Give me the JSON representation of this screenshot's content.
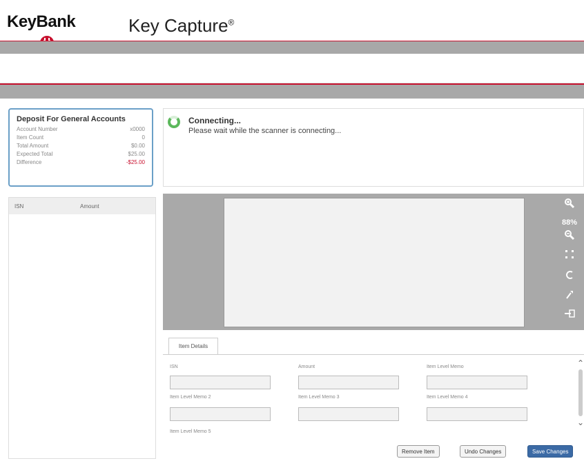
{
  "header": {
    "logo": "KeyBank",
    "app_title": "Key Capture",
    "app_title_mark": "®",
    "colors": {
      "brand_red": "#c8102e",
      "band_gray": "#a8a8a8"
    }
  },
  "deposit": {
    "title": "Deposit For General Accounts",
    "rows": [
      {
        "label": "Account Number",
        "value": "x0000"
      },
      {
        "label": "Item Count",
        "value": "0"
      },
      {
        "label": "Total Amount",
        "value": "$0.00"
      },
      {
        "label": "Expected Total",
        "value": "$25.00"
      },
      {
        "label": "Difference",
        "value": "-$25.00"
      }
    ]
  },
  "item_list": {
    "columns": [
      "ISN",
      "Amount"
    ]
  },
  "connection": {
    "title": "Connecting...",
    "message": "Please wait while the scanner is connecting..."
  },
  "viewer": {
    "zoom": "88%",
    "tools": [
      "zoom-in-icon",
      "zoom-out-icon",
      "fit-icon",
      "rotate-icon",
      "pin-icon",
      "exit-icon"
    ]
  },
  "item_details": {
    "tab": "Item Details",
    "fields": [
      {
        "label": "ISN",
        "value": ""
      },
      {
        "label": "Amount",
        "value": ""
      },
      {
        "label": "Item Level Memo",
        "value": ""
      },
      {
        "label": "Item Level Memo 2",
        "value": ""
      },
      {
        "label": "Item Level Memo 3",
        "value": ""
      },
      {
        "label": "Item Level Memo 4",
        "value": ""
      },
      {
        "label": "Item Level Memo 5",
        "value": ""
      }
    ]
  },
  "actions": {
    "remove": "Remove Item",
    "undo": "Undo Changes",
    "save": "Save Changes"
  }
}
